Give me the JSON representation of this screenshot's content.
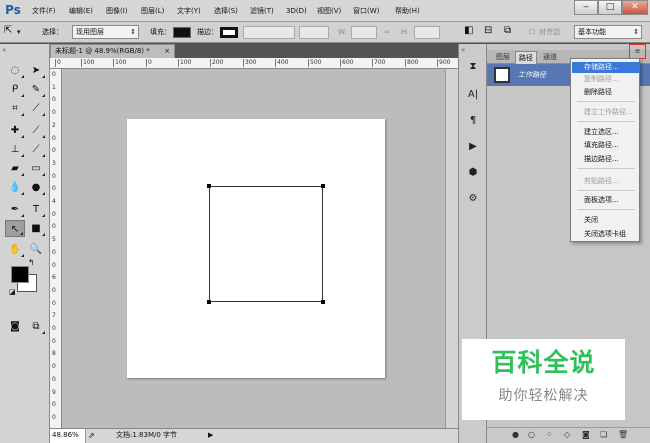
{
  "app": {
    "logo": "Ps",
    "menu": [
      "文件(F)",
      "编辑(E)",
      "图像(I)",
      "图层(L)",
      "文字(Y)",
      "选择(S)",
      "滤镜(T)",
      "3D(D)",
      "视图(V)",
      "窗口(W)",
      "帮助(H)"
    ],
    "window_controls": {
      "minimize": "‒",
      "maximize": "□",
      "close": "✕"
    }
  },
  "options_bar": {
    "select_label": "选择：",
    "select_value": "现用图层",
    "fill_label": "填充：",
    "stroke_label": "描边：",
    "w_label": "W:",
    "h_label": "H:",
    "align_edges_label": "对齐边",
    "workspace_value": "基本功能"
  },
  "document": {
    "tab_title": "未标题-1 @ 48.9%(RGB/8) *",
    "tab_close": "×",
    "ruler_top": [
      "0",
      "100",
      "100",
      "0",
      "100",
      "200",
      "300",
      "400",
      "500",
      "600",
      "700",
      "800",
      "900"
    ],
    "ruler_left": [
      "0",
      "1",
      "0",
      "0",
      "2",
      "0",
      "0",
      "3",
      "0",
      "0",
      "4",
      "0",
      "0",
      "5",
      "0",
      "0",
      "6",
      "0",
      "0",
      "7",
      "0",
      "0",
      "8",
      "0",
      "0",
      "9",
      "0",
      "0"
    ],
    "zoom": "48.86%",
    "doc_info": "文档:1.83M/0 字节"
  },
  "paths_panel": {
    "tabs": [
      "图层",
      "路径",
      "通道"
    ],
    "active_tab": "路径",
    "path_item": "工作路径"
  },
  "flyout_menu": {
    "items": [
      {
        "label": "存储路径...",
        "state": "selected"
      },
      {
        "label": "复制路径...",
        "state": "disabled"
      },
      {
        "label": "删除路径",
        "state": "normal"
      },
      {
        "label": "建立工作路径...",
        "state": "disabled"
      },
      {
        "label": "建立选区...",
        "state": "normal"
      },
      {
        "label": "填充路径...",
        "state": "normal"
      },
      {
        "label": "描边路径...",
        "state": "normal"
      },
      {
        "label": "剪贴路径...",
        "state": "disabled"
      },
      {
        "label": "面板选项...",
        "state": "normal"
      },
      {
        "label": "关闭",
        "state": "normal"
      },
      {
        "label": "关闭选项卡组",
        "state": "normal"
      }
    ]
  },
  "watermark": {
    "title": "百科全说",
    "subtitle": "助你轻松解决"
  },
  "colors": {
    "selection_blue": "#3c78d8",
    "path_row": "#5677b3",
    "watermark_green": "#2fc05a"
  }
}
